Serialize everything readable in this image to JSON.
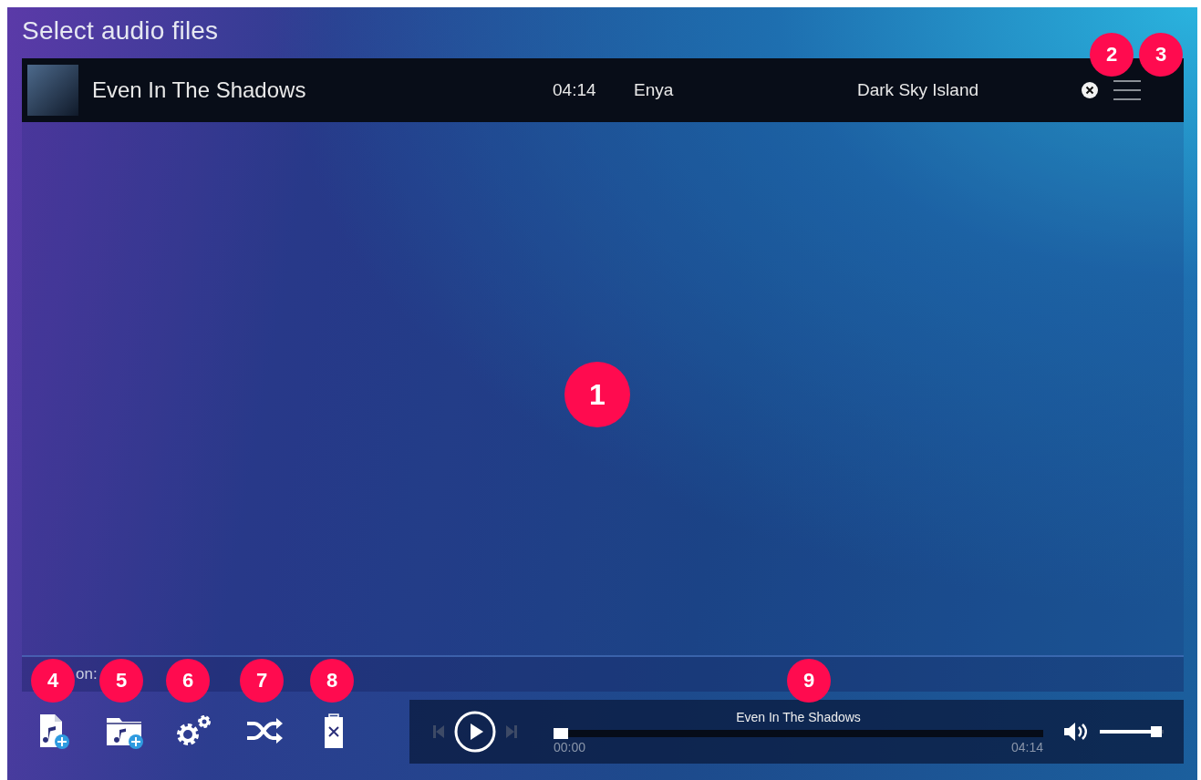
{
  "window": {
    "title": "Select audio files"
  },
  "tracks": [
    {
      "title": "Even In The Shadows",
      "duration": "04:14",
      "artist": "Enya",
      "album": "Dark Sky Island",
      "selected": false
    }
  ],
  "status_bar": {
    "text": "on:"
  },
  "toolbar": [
    {
      "kind": "add-file"
    },
    {
      "kind": "add-folder"
    },
    {
      "kind": "settings"
    },
    {
      "kind": "shuffle"
    },
    {
      "kind": "clear"
    }
  ],
  "player": {
    "now_playing": "Even In The Shadows",
    "elapsed": "00:00",
    "total": "04:14",
    "progress": {
      "level": 0.0
    },
    "volume": {
      "level": 0.88
    }
  },
  "callouts": [
    "1",
    "2",
    "3",
    "4",
    "5",
    "6",
    "7",
    "8",
    "9"
  ]
}
